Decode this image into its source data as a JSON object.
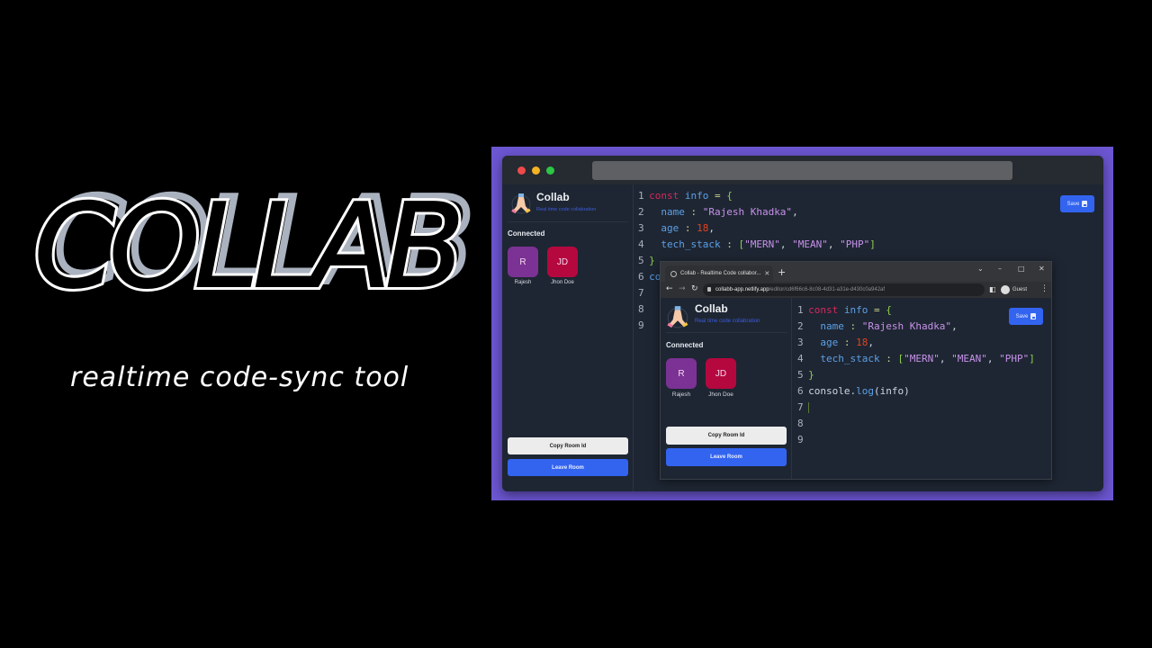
{
  "hero": {
    "title": "COLLAB",
    "subtitle": "realtime code-sync tool"
  },
  "colors": {
    "frame": "#6c56d1",
    "editor_bg": "#1e2633",
    "accent": "#3364f0",
    "avatar_r": "#7b3294",
    "avatar_jd": "#b5083f"
  },
  "app": {
    "brand_name": "Collab",
    "tagline": "Real time code collabration",
    "connected_label": "Connected",
    "clients": [
      {
        "initials": "R",
        "name": "Rajesh"
      },
      {
        "initials": "JD",
        "name": "Jhon Doe"
      }
    ],
    "copy_room_label": "Copy Room Id",
    "leave_room_label": "Leave Room",
    "save_label": "Save"
  },
  "code": {
    "line_numbers": [
      "1",
      "2",
      "3",
      "4",
      "5",
      "6",
      "7",
      "8",
      "9"
    ],
    "lines": [
      "const info = {",
      "  name : \"Rajesh Khadka\",",
      "  age : 18,",
      "  tech_stack : [\"MERN\", \"MEAN\", \"PHP\"]",
      "}",
      "console.log(info)",
      "",
      "",
      ""
    ],
    "outer_line6_partial": "co"
  },
  "browser": {
    "tab_title": "Collab - Realtime Code collabor...",
    "new_tab": "+",
    "url_host": "collabb-app.netlify.app",
    "url_path": "/editor/cd6f66c6-8c08-4d31-a31e-d430c0a942af",
    "profile_label": "Guest",
    "window_controls": [
      "⌄",
      "–",
      "□",
      "✕"
    ]
  }
}
